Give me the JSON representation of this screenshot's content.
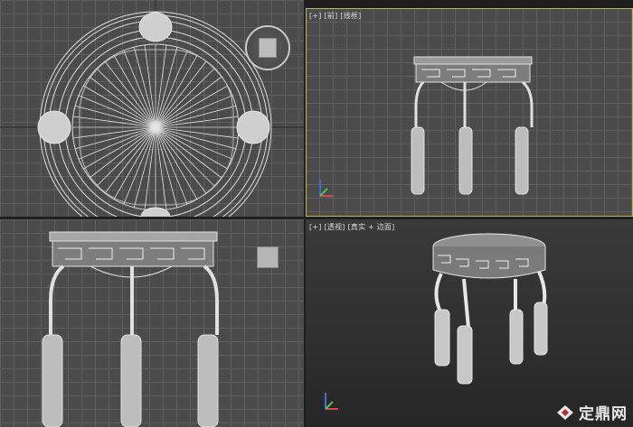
{
  "viewports": {
    "top": {
      "name": "top-viewport"
    },
    "front": {
      "labels": [
        "[+]",
        "[前]",
        "[线框]"
      ]
    },
    "left": {
      "name": "left-viewport"
    },
    "perspective": {
      "labels": [
        "[+]",
        "[透视]",
        "[真实 + 边面]"
      ]
    }
  },
  "watermark": {
    "text": "定鼎网"
  },
  "colors": {
    "wire": "#d8d8d8",
    "active_border": "#c8b45a",
    "grid_bg": "#4b4b4b"
  }
}
